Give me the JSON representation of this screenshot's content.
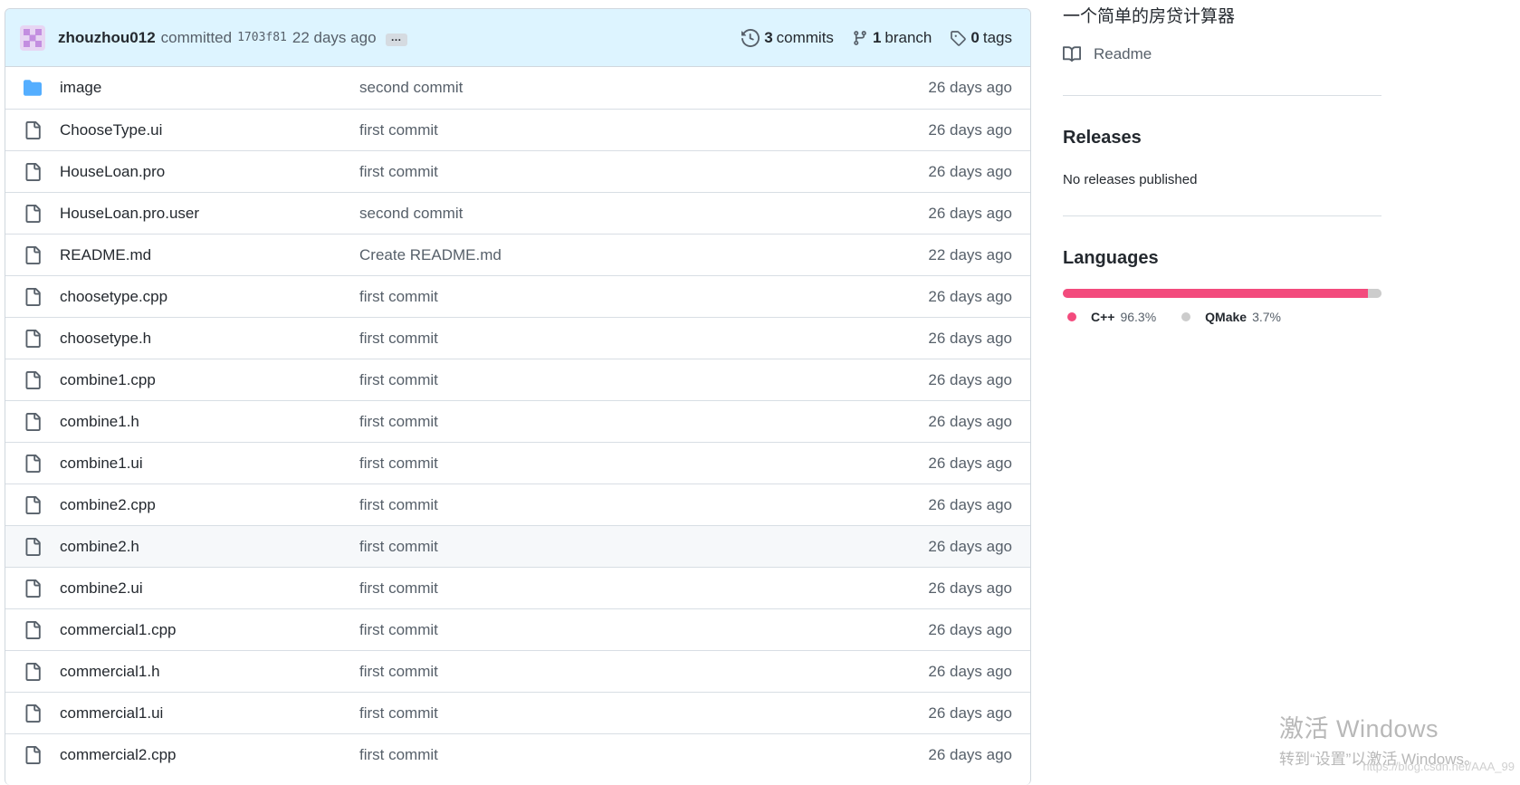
{
  "commit_bar": {
    "author": "zhouzhou012",
    "verb": "committed",
    "sha": "1703f81",
    "time": "22 days ago",
    "ellipsis": "…",
    "commits_count": "3",
    "commits_label": "commits",
    "branch_count": "1",
    "branch_label": "branch",
    "tags_count": "0",
    "tags_label": "tags"
  },
  "files": [
    {
      "name": "image",
      "type": "folder",
      "message": "second commit",
      "age": "26 days ago"
    },
    {
      "name": "ChooseType.ui",
      "type": "file",
      "message": "first commit",
      "age": "26 days ago"
    },
    {
      "name": "HouseLoan.pro",
      "type": "file",
      "message": "first commit",
      "age": "26 days ago"
    },
    {
      "name": "HouseLoan.pro.user",
      "type": "file",
      "message": "second commit",
      "age": "26 days ago"
    },
    {
      "name": "README.md",
      "type": "file",
      "message": "Create README.md",
      "age": "22 days ago"
    },
    {
      "name": "choosetype.cpp",
      "type": "file",
      "message": "first commit",
      "age": "26 days ago"
    },
    {
      "name": "choosetype.h",
      "type": "file",
      "message": "first commit",
      "age": "26 days ago"
    },
    {
      "name": "combine1.cpp",
      "type": "file",
      "message": "first commit",
      "age": "26 days ago"
    },
    {
      "name": "combine1.h",
      "type": "file",
      "message": "first commit",
      "age": "26 days ago"
    },
    {
      "name": "combine1.ui",
      "type": "file",
      "message": "first commit",
      "age": "26 days ago"
    },
    {
      "name": "combine2.cpp",
      "type": "file",
      "message": "first commit",
      "age": "26 days ago"
    },
    {
      "name": "combine2.h",
      "type": "file",
      "message": "first commit",
      "age": "26 days ago"
    },
    {
      "name": "combine2.ui",
      "type": "file",
      "message": "first commit",
      "age": "26 days ago"
    },
    {
      "name": "commercial1.cpp",
      "type": "file",
      "message": "first commit",
      "age": "26 days ago"
    },
    {
      "name": "commercial1.h",
      "type": "file",
      "message": "first commit",
      "age": "26 days ago"
    },
    {
      "name": "commercial1.ui",
      "type": "file",
      "message": "first commit",
      "age": "26 days ago"
    },
    {
      "name": "commercial2.cpp",
      "type": "file",
      "message": "first commit",
      "age": "26 days ago"
    }
  ],
  "sidebar": {
    "about": "一个简单的房贷计算器",
    "readme_label": "Readme",
    "releases_title": "Releases",
    "releases_empty": "No releases published",
    "languages_title": "Languages",
    "languages": [
      {
        "name": "C++",
        "percent": "96.3%",
        "value": 96.3,
        "color": "#f34b7d"
      },
      {
        "name": "QMake",
        "percent": "3.7%",
        "value": 3.7,
        "color": "#cccccc"
      }
    ]
  },
  "watermark": {
    "activate_title": "激活 Windows",
    "activate_sub": "转到“设置”以激活 Windows。",
    "csdn": "https://blog.csdn.net/AAA_99"
  }
}
